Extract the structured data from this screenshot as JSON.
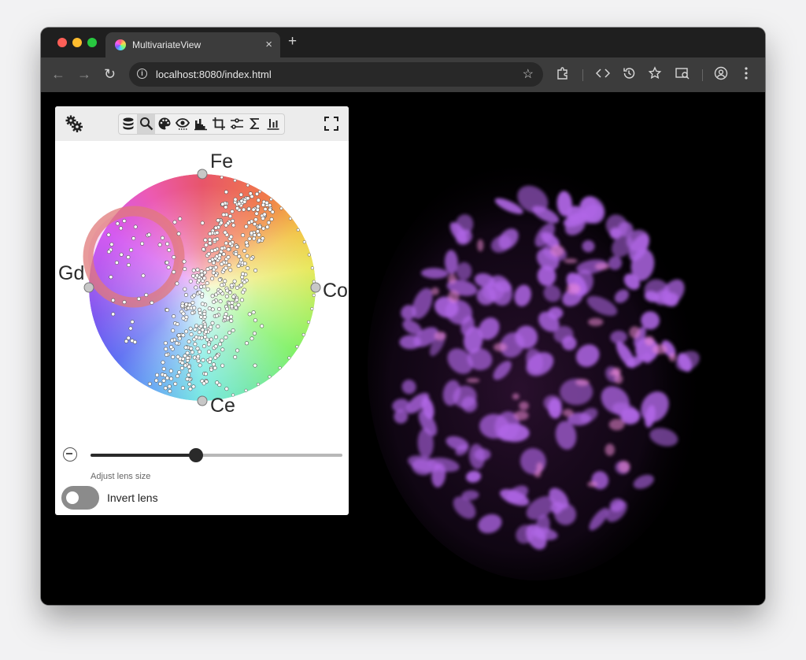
{
  "browser": {
    "tab_title": "MultivariateView",
    "tab_close": "×",
    "new_tab": "+",
    "url": "localhost:8080/index.html",
    "back": "←",
    "forward": "→",
    "reload": "↻",
    "bookmark": "☆"
  },
  "panel": {
    "toolbar": {
      "tools": [
        "database",
        "search",
        "palette",
        "visibility",
        "histogram",
        "crop",
        "tune",
        "sigma",
        "bar-chart"
      ],
      "active_tool": "search"
    },
    "wheel": {
      "channels": [
        "Fe",
        "Co",
        "Ce",
        "Gd"
      ]
    },
    "lens_slider": {
      "value": 0.42,
      "caption": "Adjust lens size"
    },
    "invert_toggle": {
      "label": "Invert lens",
      "on": false
    }
  },
  "colors": {
    "window_bg": "#000000",
    "lens_ring": "#e07a7a",
    "blob": "#b066e6"
  }
}
